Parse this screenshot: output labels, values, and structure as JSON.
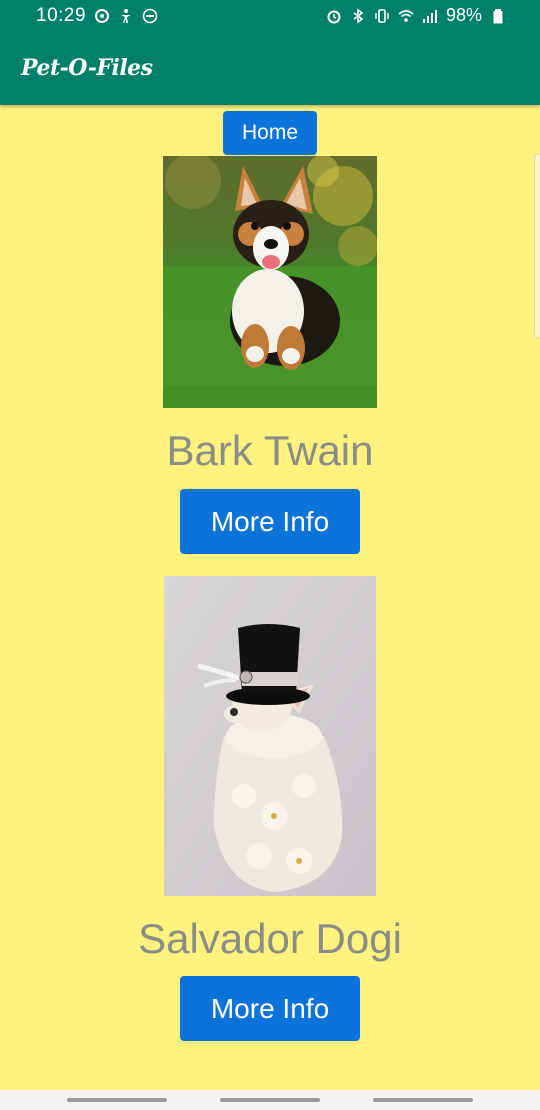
{
  "status_bar": {
    "time": "10:29",
    "battery": "98%",
    "left_icons": [
      "sync-icon",
      "accessibility-icon",
      "do-not-disturb-icon"
    ],
    "right_icons": [
      "alarm-icon",
      "bluetooth-icon",
      "vibrate-icon",
      "wifi-icon",
      "signal-icon",
      "battery-icon"
    ]
  },
  "app_bar": {
    "title": "Pet-O-Files"
  },
  "toolbar": {
    "home_label": "Home"
  },
  "pets": [
    {
      "name": "Bark Twain",
      "button_label": "More Info",
      "photo": "corgi-photo"
    },
    {
      "name": "Salvador Dogi",
      "button_label": "More Info",
      "photo": "chihuahua-top-hat-photo"
    }
  ],
  "colors": {
    "app_bar": "#00806a",
    "background": "#fff27f",
    "button": "#0b73d9",
    "name_text": "#8a8c88"
  }
}
